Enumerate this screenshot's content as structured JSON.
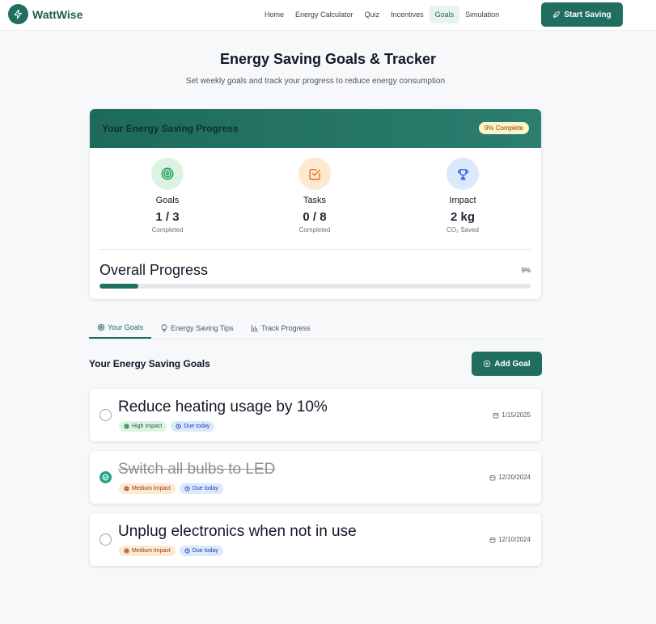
{
  "brand": {
    "name": "WattWise",
    "icon": "lightning-icon"
  },
  "nav": {
    "items": [
      {
        "label": "Home",
        "active": false
      },
      {
        "label": "Energy Calculator",
        "active": false
      },
      {
        "label": "Quiz",
        "active": false
      },
      {
        "label": "Incentives",
        "active": false
      },
      {
        "label": "Goals",
        "active": true
      },
      {
        "label": "Simulation",
        "active": false
      }
    ],
    "cta_label": "Start Saving",
    "cta_icon": "leaf-icon"
  },
  "page": {
    "title": "Energy Saving Goals & Tracker",
    "subtitle": "Set weekly goals and track your progress to reduce energy consumption"
  },
  "progress_card": {
    "title": "Your Energy Saving Progress",
    "badge": "9% Complete",
    "stats": [
      {
        "label": "Goals",
        "value": "1 / 3",
        "sub": "Completed",
        "icon": "target-icon",
        "color": "#1f9d55",
        "bg": "#dcf3e4"
      },
      {
        "label": "Tasks",
        "value": "0 / 8",
        "sub": "Completed",
        "icon": "checkbox-icon",
        "color": "#ea6c1a",
        "bg": "#fde8d0"
      },
      {
        "label": "Impact",
        "value": "2 kg",
        "sub": "CO₂ Saved",
        "icon": "trophy-icon",
        "color": "#2563eb",
        "bg": "#dce8fb"
      }
    ],
    "overall_title": "Overall Progress",
    "overall_percent_label": "9%",
    "overall_percent": 9
  },
  "tabs": [
    {
      "label": "Your Goals",
      "icon": "target-icon",
      "active": true
    },
    {
      "label": "Energy Saving Tips",
      "icon": "lightbulb-icon",
      "active": false
    },
    {
      "label": "Track Progress",
      "icon": "bar-chart-icon",
      "active": false
    }
  ],
  "goals_section": {
    "title": "Your Energy Saving Goals",
    "add_label": "Add Goal",
    "goals": [
      {
        "title": "Reduce heating usage by 10%",
        "impact": "High Impact",
        "due": "Due today",
        "date": "1/15/2025",
        "completed": false
      },
      {
        "title": "Switch all bulbs to LED",
        "impact": "Medium Impact",
        "due": "Due today",
        "date": "12/20/2024",
        "completed": true
      },
      {
        "title": "Unplug electronics when not in use",
        "impact": "Medium Impact",
        "due": "Due today",
        "date": "12/10/2024",
        "completed": false
      }
    ]
  },
  "colors": {
    "primary": "#1f6e60",
    "accent": "#20a58a"
  }
}
